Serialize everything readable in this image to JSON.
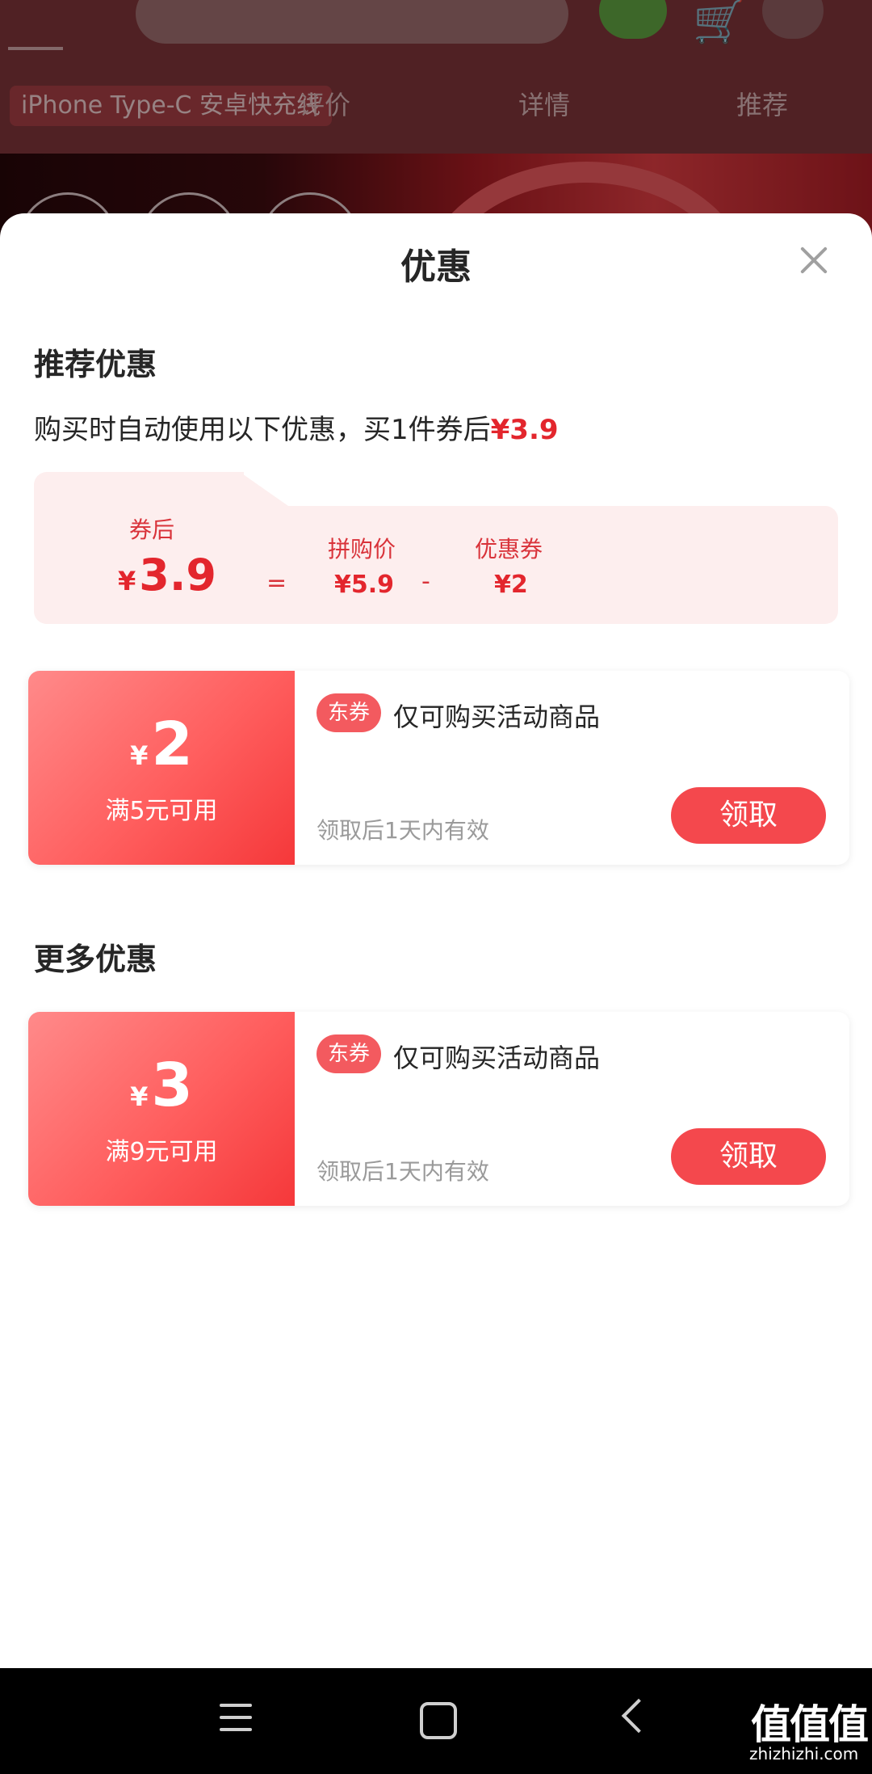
{
  "background_page": {
    "tag": "iPhone Type-C 安卓快充线",
    "tabs": [
      "评价",
      "详情",
      "推荐"
    ]
  },
  "sheet": {
    "title": "优惠",
    "recommend": {
      "title": "推荐优惠",
      "desc_prefix": "购买时自动使用以下优惠，买1件券后",
      "desc_price": "¥3.9"
    },
    "formula": {
      "after_label": "券后",
      "after_yen": "¥",
      "after_value": "3.9",
      "equals": "=",
      "group_label": "拼购价",
      "group_value": "¥5.9",
      "minus": "-",
      "coupon_label": "优惠券",
      "coupon_value": "¥2"
    },
    "recommended_coupons": [
      {
        "yen": "¥",
        "amount": "2",
        "condition": "满5元可用",
        "badge": "东券",
        "name": "仅可购买活动商品",
        "validity": "领取后1天内有效",
        "button": "领取"
      }
    ],
    "more": {
      "title": "更多优惠"
    },
    "more_coupons": [
      {
        "yen": "¥",
        "amount": "3",
        "condition": "满9元可用",
        "badge": "东券",
        "name": "仅可购买活动商品",
        "validity": "领取后1天内有效",
        "button": "领取"
      }
    ]
  },
  "watermark": {
    "text": "值值值",
    "url": "zhizhizhi.com"
  },
  "colors": {
    "accent": "#e3262d",
    "button": "#f4484d",
    "formula_bg": "#fdeeee"
  }
}
